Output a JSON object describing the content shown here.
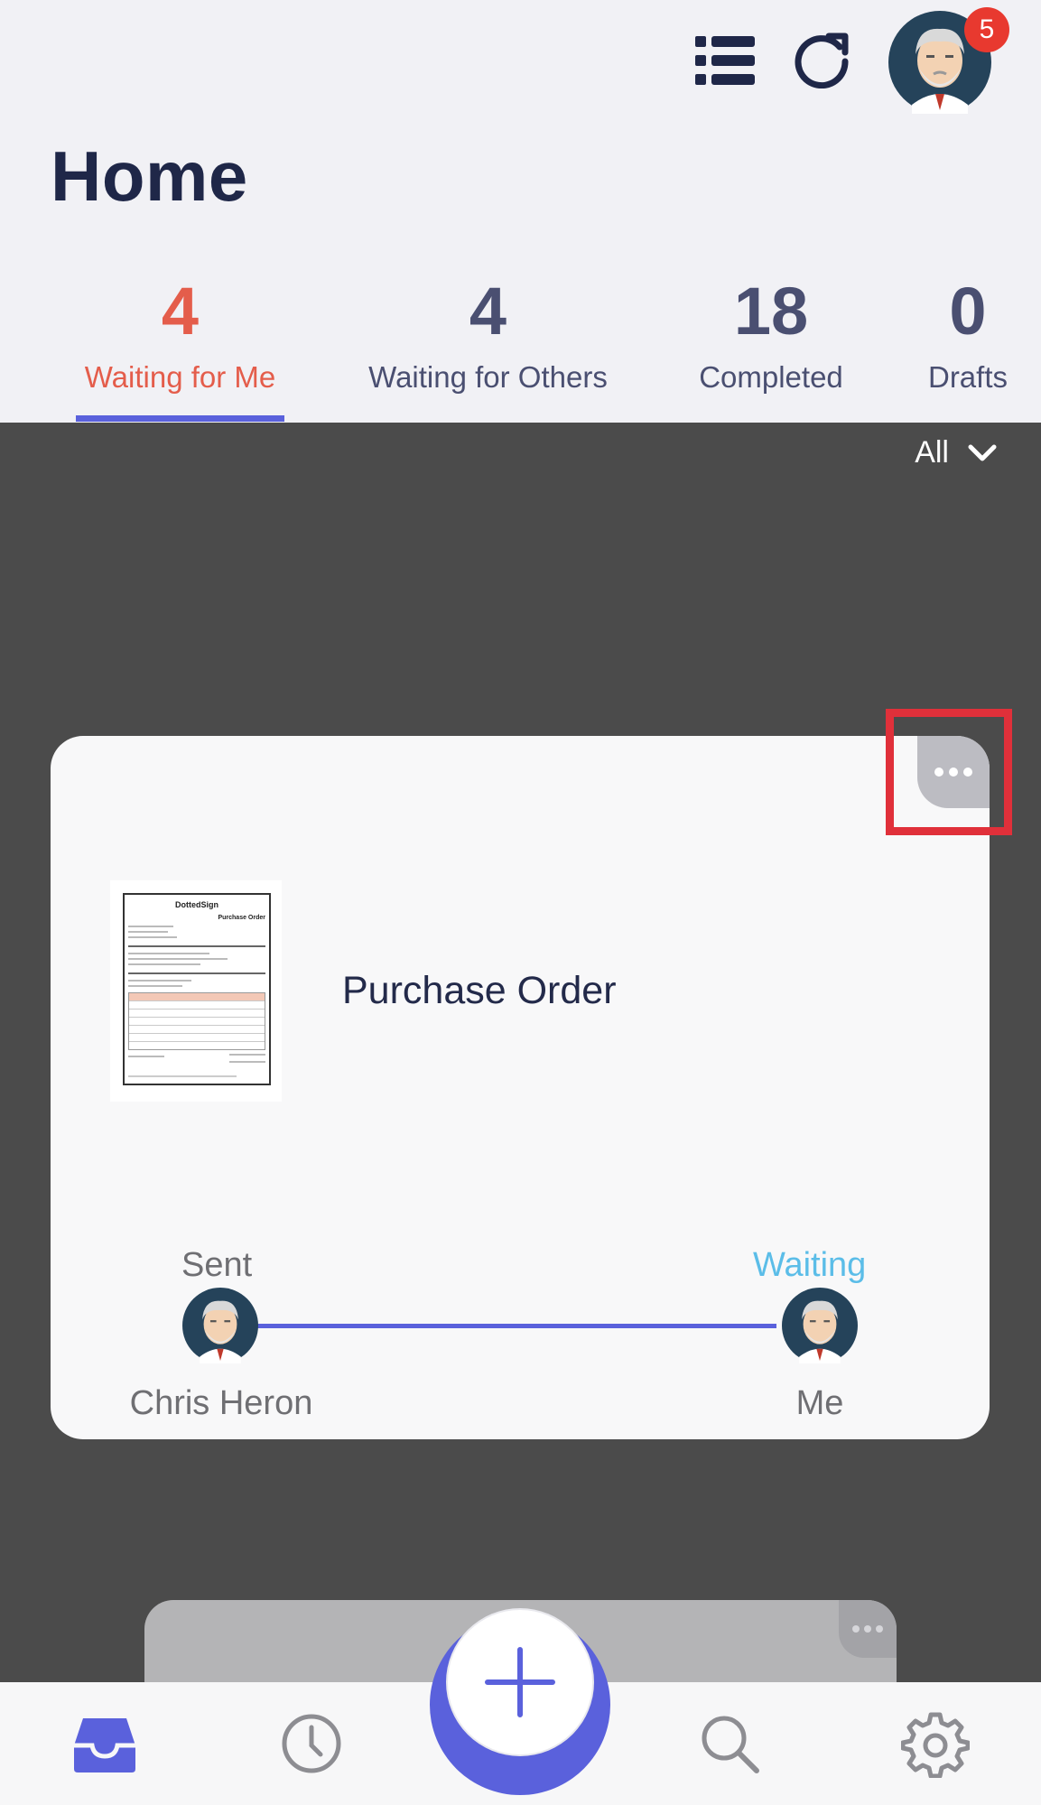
{
  "header": {
    "title": "Home",
    "notification_count": "5",
    "icons": [
      "list-icon",
      "refresh-icon"
    ]
  },
  "tabs": [
    {
      "count": "4",
      "label": "Waiting for Me",
      "active": true
    },
    {
      "count": "4",
      "label": "Waiting for Others",
      "active": false
    },
    {
      "count": "18",
      "label": "Completed",
      "active": false
    },
    {
      "count": "0",
      "label": "Drafts",
      "active": false
    }
  ],
  "filter": {
    "label": "All"
  },
  "card": {
    "title": "Purchase Order",
    "thumbnail": {
      "brand": "DottedSign",
      "heading": "Purchase Order"
    },
    "flow": {
      "sender_status": "Sent",
      "sender_name": "Chris Heron",
      "receiver_status": "Waiting",
      "receiver_name": "Me"
    }
  },
  "bottom_nav": {
    "items": [
      "inbox-icon",
      "clock-icon",
      "add-icon",
      "search-icon",
      "settings-icon"
    ],
    "active": "inbox-icon"
  },
  "colors": {
    "accent": "#5a61dc",
    "active_tab_text": "#e45d4b",
    "waiting": "#5bbde8",
    "badge": "#e8392f",
    "dark_bg": "#4b4b4b",
    "highlight": "#e0303a"
  }
}
